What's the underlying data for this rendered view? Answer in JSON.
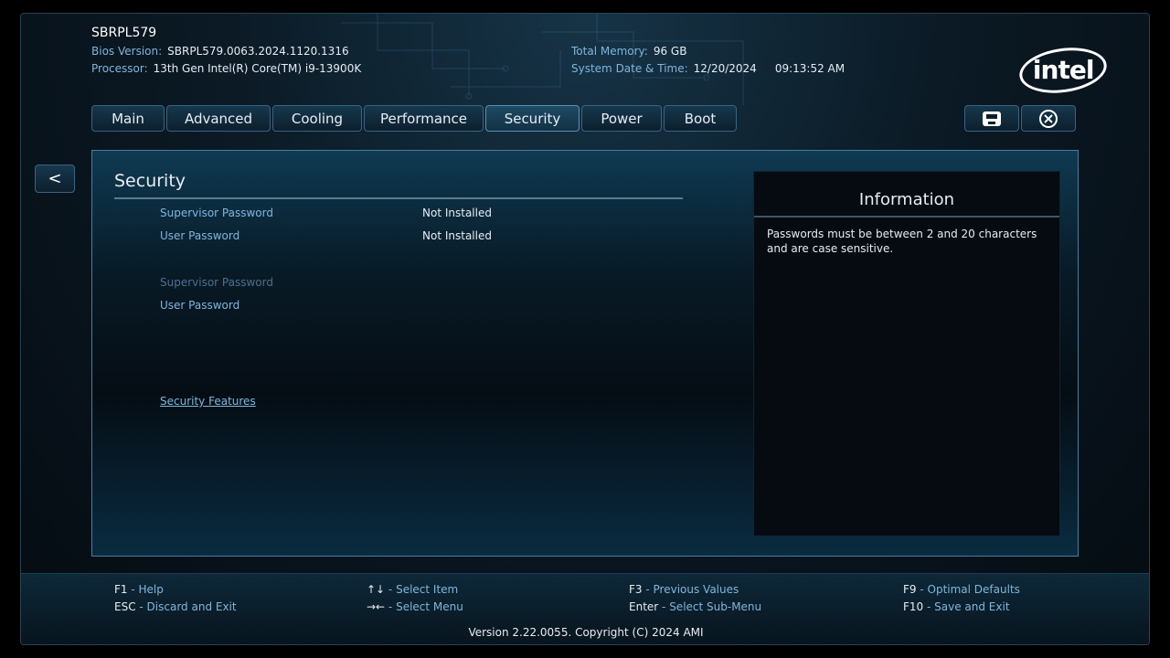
{
  "header": {
    "title": "SBRPL579",
    "bios_label": "Bios Version:",
    "bios_value": "SBRPL579.0063.2024.1120.1316",
    "processor_label": "Processor:",
    "processor_value": "13th Gen Intel(R) Core(TM) i9-13900K",
    "memory_label": "Total Memory:",
    "memory_value": "96 GB",
    "datetime_label": "System Date & Time:",
    "date_value": "12/20/2024",
    "time_value": "09:13:52 AM",
    "logo_text": "intel"
  },
  "tabs": [
    {
      "label": "Main"
    },
    {
      "label": "Advanced"
    },
    {
      "label": "Cooling"
    },
    {
      "label": "Performance"
    },
    {
      "label": "Security"
    },
    {
      "label": "Power"
    },
    {
      "label": "Boot"
    }
  ],
  "toolbar": {
    "save_icon": "save-icon",
    "exit_icon": "close-icon",
    "back_label": "<"
  },
  "main": {
    "section_title": "Security",
    "rows": [
      {
        "label": "Supervisor Password",
        "value": "Not Installed"
      },
      {
        "label": "User Password",
        "value": "Not Installed"
      }
    ],
    "actions": [
      {
        "label": "Supervisor Password",
        "state": "disabled"
      },
      {
        "label": "User Password",
        "state": "enabled"
      }
    ],
    "link": {
      "label": "Security Features"
    }
  },
  "info": {
    "title": "Information",
    "text": "Passwords must be between 2 and 20 characters and are case sensitive."
  },
  "footer": {
    "keys": [
      {
        "key": "F1",
        "desc": "Help"
      },
      {
        "key": "ESC",
        "desc": "Discard and Exit"
      },
      {
        "key": "↑↓",
        "desc": "Select Item"
      },
      {
        "key": "→←",
        "desc": "Select Menu"
      },
      {
        "key": "F3",
        "desc": "Previous Values"
      },
      {
        "key": "Enter",
        "desc": "Select Sub-Menu"
      },
      {
        "key": "F9",
        "desc": "Optimal Defaults"
      },
      {
        "key": "F10",
        "desc": "Save and Exit"
      }
    ],
    "separator": " - ",
    "version": "Version 2.22.0055. Copyright (C) 2024 AMI"
  },
  "colors": {
    "accent": "#7fb6dd",
    "text": "#e6edf3",
    "border": "#3a6380",
    "panel_border": "#4b7d9c"
  }
}
